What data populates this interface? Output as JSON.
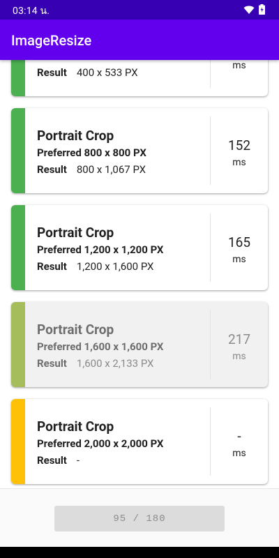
{
  "status": {
    "time": "03:14 น."
  },
  "app": {
    "title": "ImageResize"
  },
  "colors": {
    "green": "#4CAF50",
    "lime": "#A5BD5A",
    "amber": "#FFC107"
  },
  "cards": [
    {
      "name": "",
      "preferred": "",
      "result_label": "Result",
      "result_value": "400 x 533 PX",
      "ms": "",
      "ms_unit": "ms",
      "accent": "green"
    },
    {
      "name": "Portrait Crop",
      "preferred": "Preferred 800 x 800 PX",
      "result_label": "Result",
      "result_value": "800 x 1,067 PX",
      "ms": "152",
      "ms_unit": "ms",
      "accent": "green"
    },
    {
      "name": "Portrait Crop",
      "preferred": "Preferred 1,200 x 1,200 PX",
      "result_label": "Result",
      "result_value": "1,200 x 1,600 PX",
      "ms": "165",
      "ms_unit": "ms",
      "accent": "green"
    },
    {
      "name": "Portrait Crop",
      "preferred": "Preferred 1,600 x 1,600 PX",
      "result_label": "Result",
      "result_value": "1,600 x 2,133 PX",
      "ms": "217",
      "ms_unit": "ms",
      "accent": "lime",
      "state": "in-progress"
    },
    {
      "name": "Portrait Crop",
      "preferred": "Preferred 2,000 x 2,000 PX",
      "result_label": "Result",
      "result_value": "-",
      "ms": "-",
      "ms_unit": "ms",
      "accent": "amber",
      "state": "pending"
    }
  ],
  "progress": {
    "label": "95 / 180",
    "done": 95,
    "total": 180
  }
}
